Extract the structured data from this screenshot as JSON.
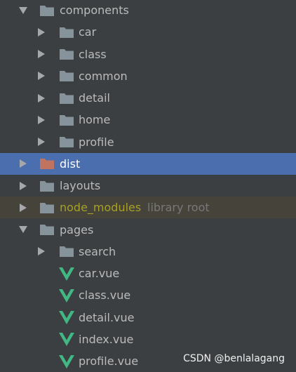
{
  "colors": {
    "background": "#3c3f41",
    "selected_row": "#4b6eaf",
    "excluded_row": "#45433a",
    "folder": "#87939a",
    "folder_dist": "#c0735e",
    "vue_green": "#41b883",
    "library_label": "#a6a02a",
    "text": "#bbbbbb"
  },
  "tree": {
    "items": [
      {
        "label": "components",
        "icon": "folder-icon",
        "arrow": "expanded",
        "depth": 0
      },
      {
        "label": "car",
        "icon": "folder-icon",
        "arrow": "collapsed",
        "depth": 1
      },
      {
        "label": "class",
        "icon": "folder-icon",
        "arrow": "collapsed",
        "depth": 1
      },
      {
        "label": "common",
        "icon": "folder-icon",
        "arrow": "collapsed",
        "depth": 1
      },
      {
        "label": "detail",
        "icon": "folder-icon",
        "arrow": "collapsed",
        "depth": 1
      },
      {
        "label": "home",
        "icon": "folder-icon",
        "arrow": "collapsed",
        "depth": 1
      },
      {
        "label": "profile",
        "icon": "folder-icon",
        "arrow": "collapsed",
        "depth": 1
      },
      {
        "label": "dist",
        "icon": "folder-icon",
        "arrow": "collapsed",
        "depth": 0,
        "state": "selected"
      },
      {
        "label": "layouts",
        "icon": "folder-icon",
        "arrow": "collapsed",
        "depth": 0
      },
      {
        "label": "node_modules",
        "extra": "library root",
        "icon": "folder-icon",
        "arrow": "collapsed",
        "depth": 0,
        "state": "excluded"
      },
      {
        "label": "pages",
        "icon": "folder-icon",
        "arrow": "expanded",
        "depth": 0
      },
      {
        "label": "search",
        "icon": "folder-icon",
        "arrow": "collapsed",
        "depth": 1
      },
      {
        "label": "car.vue",
        "icon": "vue-icon",
        "depth": 1
      },
      {
        "label": "class.vue",
        "icon": "vue-icon",
        "depth": 1
      },
      {
        "label": "detail.vue",
        "icon": "vue-icon",
        "depth": 1
      },
      {
        "label": "index.vue",
        "icon": "vue-icon",
        "depth": 1
      },
      {
        "label": "profile.vue",
        "icon": "vue-icon",
        "depth": 1
      }
    ]
  },
  "watermark": "CSDN @benlalagang"
}
